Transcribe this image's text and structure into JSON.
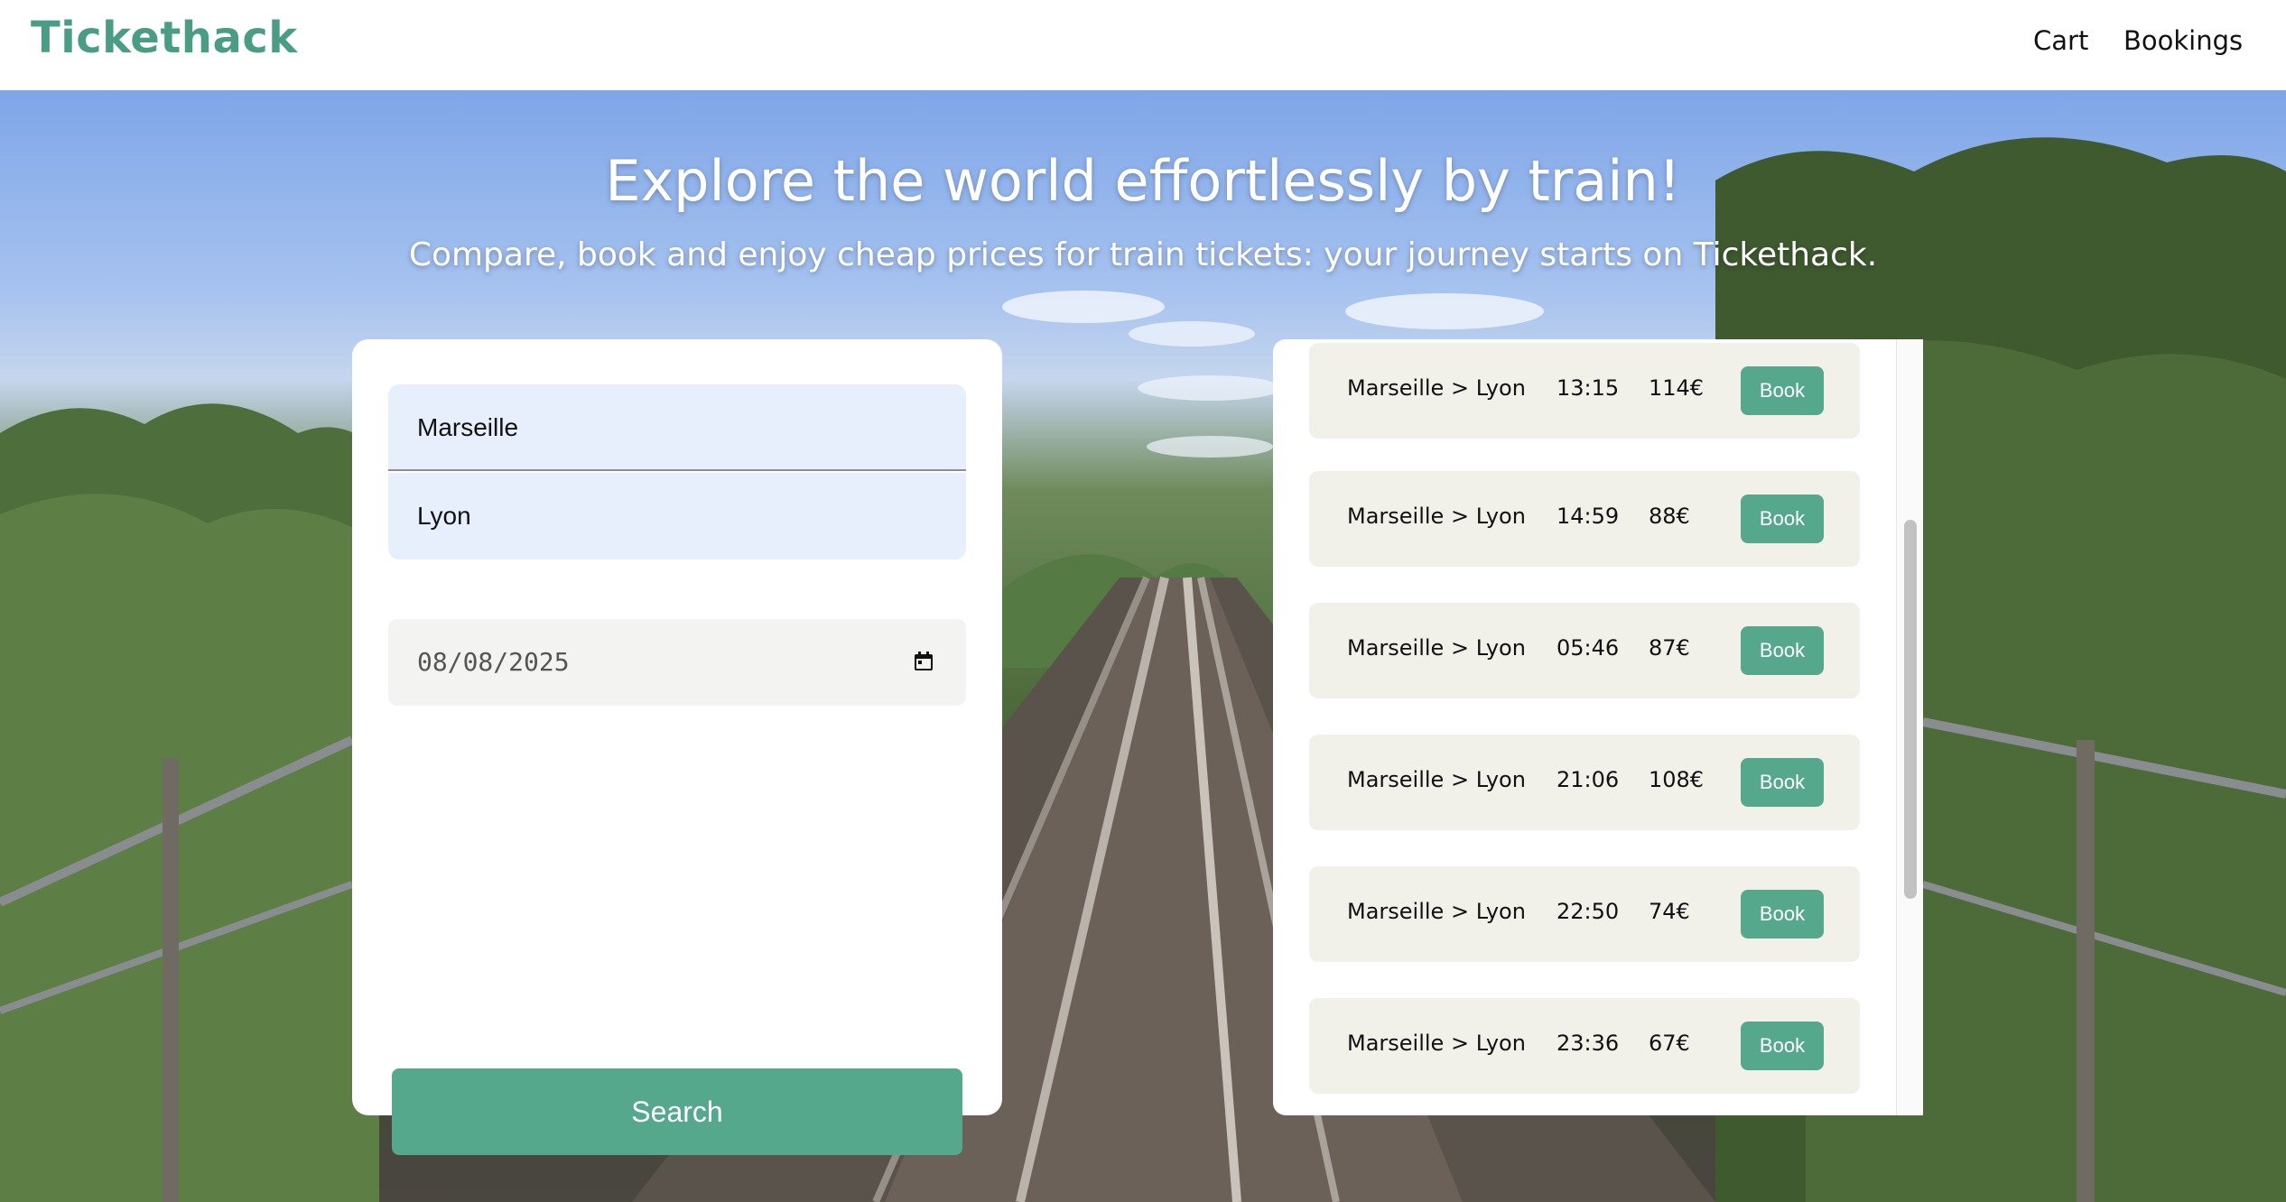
{
  "header": {
    "logo": "Tickethack",
    "nav": {
      "cart": "Cart",
      "bookings": "Bookings"
    }
  },
  "hero": {
    "title": "Explore the world effortlessly by train!",
    "subtitle": "Compare, book and enjoy cheap prices for train tickets: your journey starts on Tickethack."
  },
  "search": {
    "departure_value": "Marseille",
    "arrival_value": "Lyon",
    "date_value": "08/08/2025",
    "button_label": "Search"
  },
  "results": {
    "book_label": "Book",
    "trips": [
      {
        "route": "Marseille > Lyon",
        "time": "13:15",
        "price": "114€"
      },
      {
        "route": "Marseille > Lyon",
        "time": "14:59",
        "price": "88€"
      },
      {
        "route": "Marseille > Lyon",
        "time": "05:46",
        "price": "87€"
      },
      {
        "route": "Marseille > Lyon",
        "time": "21:06",
        "price": "108€"
      },
      {
        "route": "Marseille > Lyon",
        "time": "22:50",
        "price": "74€"
      },
      {
        "route": "Marseille > Lyon",
        "time": "23:36",
        "price": "67€"
      }
    ]
  },
  "colors": {
    "brand": "#4a9d84",
    "button": "#55a88b",
    "input_bg": "#e8effc",
    "row_bg": "#f1f0e9"
  },
  "icons": {
    "date_picker": "calendar-icon"
  }
}
